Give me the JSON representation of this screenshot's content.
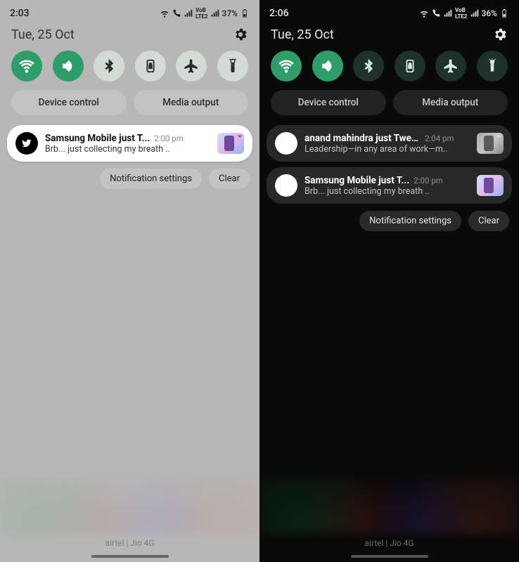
{
  "left": {
    "status": {
      "time": "2:03",
      "battery": "37%"
    },
    "date": "Tue, 25 Oct",
    "toggles": [
      "wifi",
      "sound",
      "bluetooth",
      "rotation-lock",
      "airplane",
      "flashlight"
    ],
    "active_toggles": [
      0,
      1
    ],
    "chips": {
      "device": "Device control",
      "media": "Media output"
    },
    "notifications": [
      {
        "icon": "twitter",
        "title": "Samsung Mobile just T...",
        "time": "2:00 pm",
        "subtitle": "Brb... just collecting my breath ..",
        "thumb": "color"
      }
    ],
    "footer": {
      "settings": "Notification settings",
      "clear": "Clear"
    },
    "carrier": "airtel | Jio 4G"
  },
  "right": {
    "status": {
      "time": "2:06",
      "battery": "36%"
    },
    "date": "Tue, 25 Oct",
    "toggles": [
      "wifi",
      "sound",
      "bluetooth",
      "rotation-lock",
      "airplane",
      "flashlight"
    ],
    "active_toggles": [
      0,
      1
    ],
    "chips": {
      "device": "Device control",
      "media": "Media output"
    },
    "notifications": [
      {
        "icon": "blank",
        "title": "anand mahindra just Tweet...",
        "time": "2:04 pm",
        "subtitle": "Leadership—in any area of work—m..",
        "thumb": "grey"
      },
      {
        "icon": "blank",
        "title": "Samsung Mobile just T...",
        "time": "2:00 pm",
        "subtitle": "Brb... just collecting my breath ..",
        "thumb": "color"
      }
    ],
    "footer": {
      "settings": "Notification settings",
      "clear": "Clear"
    },
    "carrier": "airtel | Jio 4G"
  }
}
